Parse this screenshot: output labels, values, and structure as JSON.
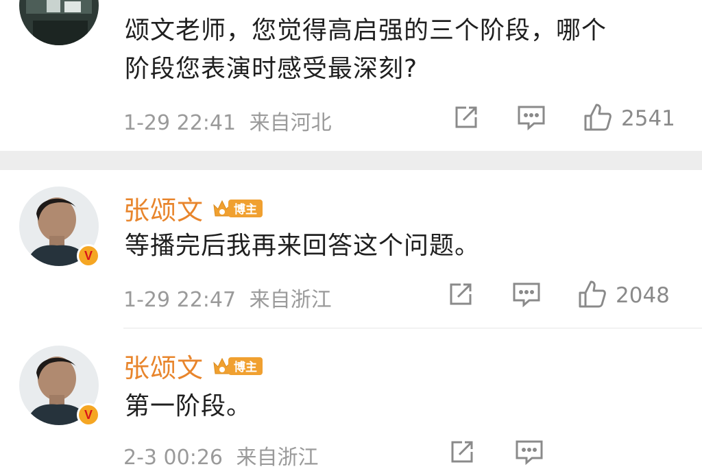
{
  "comments": [
    {
      "text_line1": "颂文老师，您觉得高启强的三个阶段，哪个",
      "text_line2": "阶段您表演时感受最深刻?",
      "time": "1-29 22:41",
      "location": "来自河北",
      "likes": "2541"
    },
    {
      "username": "张颂文",
      "badge": "博主",
      "text": "等播完后我再来回答这个问题。",
      "time": "1-29 22:47",
      "location": "来自浙江",
      "likes": "2048"
    },
    {
      "username": "张颂文",
      "badge": "博主",
      "text": "第一阶段。",
      "time": "2-3 00:26",
      "location": "来自浙江"
    }
  ],
  "colors": {
    "username": "#e8852c",
    "badge": "#f0a030",
    "verified": "#f5a623",
    "meta": "#9a9a9a",
    "divider": "#ededed"
  },
  "icons": [
    "share-icon",
    "comment-icon",
    "like-icon",
    "verified-v-icon",
    "crown-icon"
  ]
}
